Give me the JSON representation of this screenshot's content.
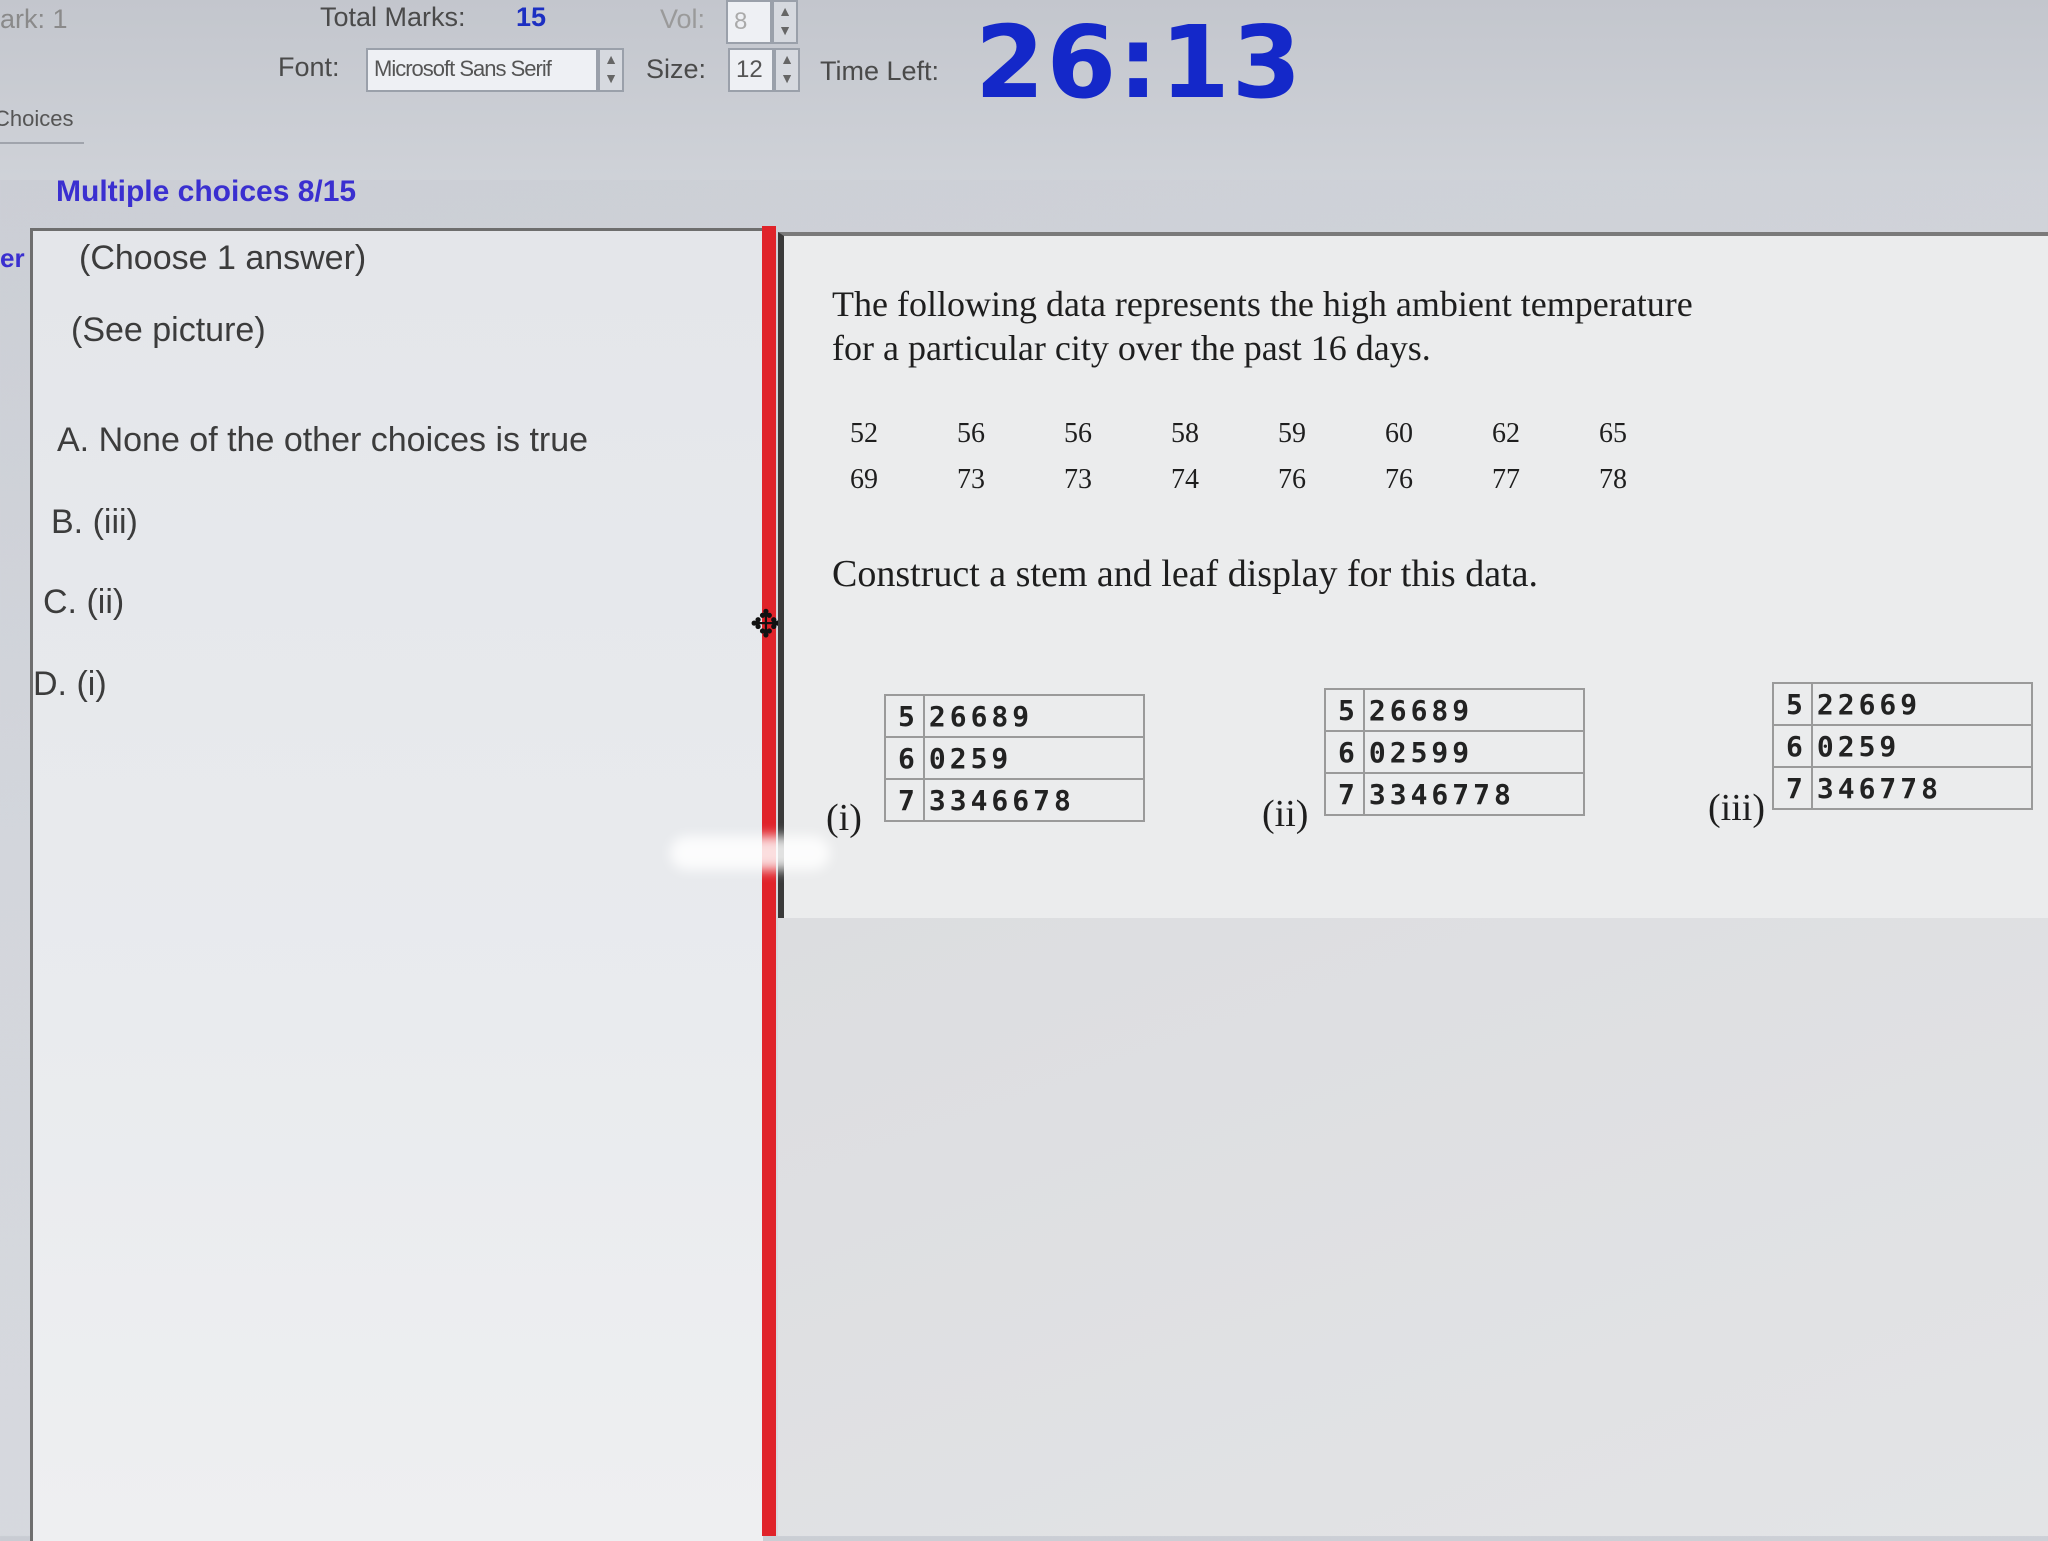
{
  "toolbar": {
    "mark_label": "ark: 1",
    "total_marks_label": "Total Marks:",
    "total_marks_value": "15",
    "vol_label": "Vol:",
    "vol_value": "8",
    "font_label": "Font:",
    "font_value": "Microsoft Sans Serif",
    "size_label": "Size:",
    "size_value": "12",
    "time_left_label": "Time Left:",
    "timer_value": "26:13"
  },
  "tabs": {
    "choices_label": "Choices"
  },
  "section": {
    "heading": "Multiple choices 8/15",
    "edge_label": "er"
  },
  "left": {
    "instruction": "(Choose 1 answer)",
    "see_picture": "(See picture)",
    "options": [
      {
        "letter": "A.",
        "text": "None of the other choices is true"
      },
      {
        "letter": "B.",
        "text": "(iii)"
      },
      {
        "letter": "C.",
        "text": "(ii)"
      },
      {
        "letter": "D.",
        "text": "(i)"
      }
    ]
  },
  "question": {
    "line1": "The following data represents the high ambient temperature",
    "line2": "for a particular city over the past 16 days.",
    "data_row1": [
      "52",
      "56",
      "56",
      "58",
      "59",
      "60",
      "62",
      "65"
    ],
    "data_row2": [
      "69",
      "73",
      "73",
      "74",
      "76",
      "76",
      "77",
      "78"
    ],
    "instruction": "Construct a stem and leaf display for this data."
  },
  "displays": [
    {
      "label": "(i)",
      "rows": [
        {
          "stem": "5",
          "leaves": "26689"
        },
        {
          "stem": "6",
          "leaves": "0259"
        },
        {
          "stem": "7",
          "leaves": "3346678"
        }
      ]
    },
    {
      "label": "(ii)",
      "rows": [
        {
          "stem": "5",
          "leaves": "26689"
        },
        {
          "stem": "6",
          "leaves": "02599"
        },
        {
          "stem": "7",
          "leaves": "3346778"
        }
      ]
    },
    {
      "label": "(iii)",
      "rows": [
        {
          "stem": "5",
          "leaves": "22669"
        },
        {
          "stem": "6",
          "leaves": "0259"
        },
        {
          "stem": "7",
          "leaves": "346778"
        }
      ]
    }
  ]
}
